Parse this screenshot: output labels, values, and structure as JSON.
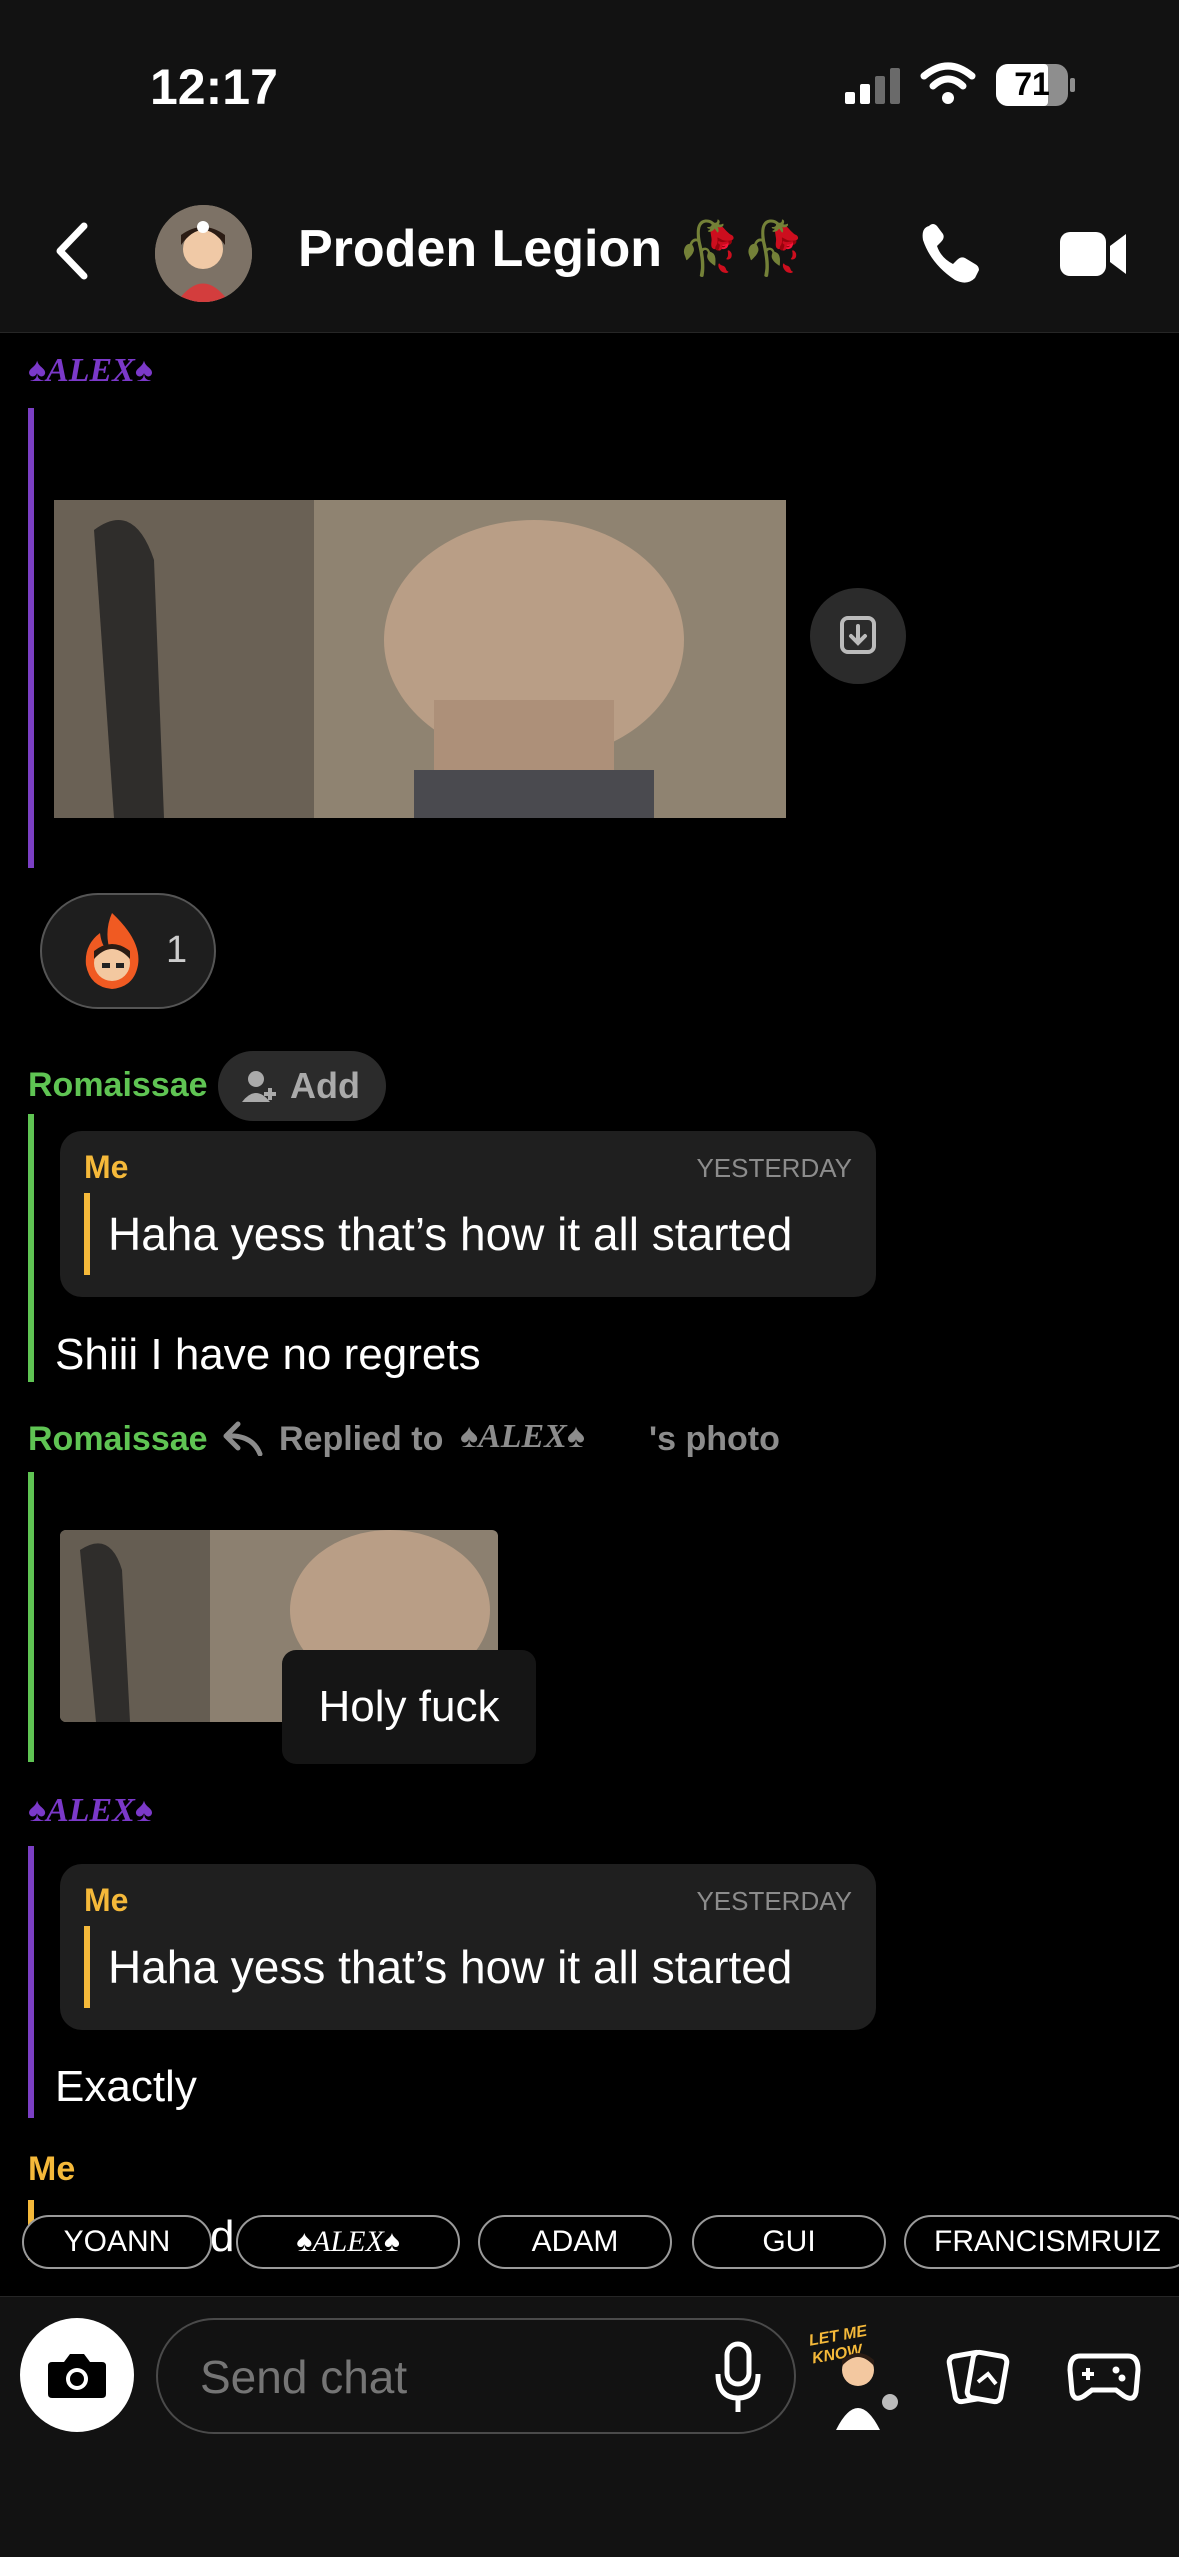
{
  "status_bar": {
    "time": "12:17",
    "battery": "71"
  },
  "header": {
    "title": "Proden Legion 🥀🥀"
  },
  "messages": {
    "alex_name": "♠ALEX♠",
    "reaction_count": "1",
    "romaissae_name": "Romaissae",
    "add_label": "Add",
    "quote1": {
      "sender": "Me",
      "time": "YESTERDAY",
      "text": "Haha yess that’s how it all started"
    },
    "romaissae_msg": "Shiii I have no regrets",
    "replied_label": "Replied to",
    "replied_target": "♠ALEX♠",
    "replied_suffix": "'s photo",
    "holy_caption": "Holy fuck",
    "quote2": {
      "sender": "Me",
      "time": "YESTERDAY",
      "text": "Haha yess that’s how it all started"
    },
    "alex_msg": "Exactly",
    "me_label": "Me",
    "me_partial": "d"
  },
  "mention_chips": [
    "YOANN",
    "♠ALEX♠",
    "ADAM",
    "GUI",
    "FRANCISMRUIZ"
  ],
  "composer": {
    "placeholder": "Send chat",
    "sticker_text": "LET ME KNOW"
  }
}
